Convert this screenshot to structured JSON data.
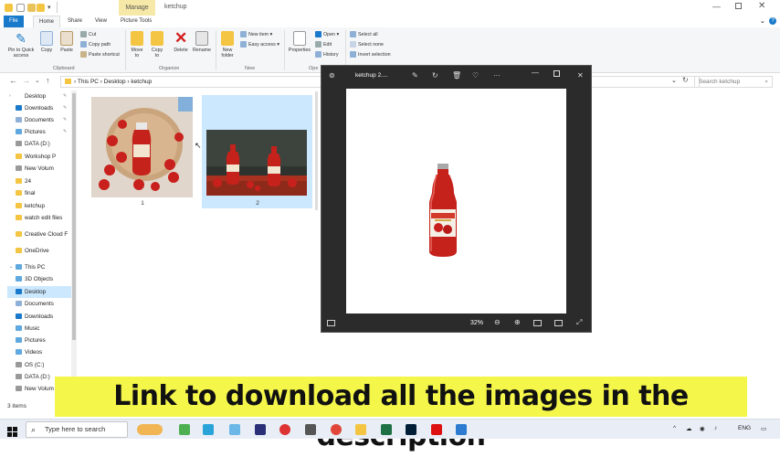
{
  "explorer": {
    "title": "ketchup",
    "contextual_tab": "Manage",
    "tabs": [
      "File",
      "Home",
      "Share",
      "View",
      "Picture Tools"
    ],
    "ribbon": {
      "pin_label": "Pin to Quick access",
      "copy_label": "Copy",
      "paste_label": "Paste",
      "cut_label": "Cut",
      "copy_path_label": "Copy path",
      "paste_shortcut_label": "Paste shortcut",
      "clipboard_group": "Clipboard",
      "move_to_label": "Move to",
      "copy_to_label": "Copy to",
      "delete_label": "Delete",
      "rename_label": "Rename",
      "organize_group": "Organize",
      "new_folder_label": "New folder",
      "new_item_label": "New item",
      "easy_access_label": "Easy access",
      "new_group": "New",
      "properties_label": "Properties",
      "open_label": "Open",
      "edit_label": "Edit",
      "history_label": "History",
      "open_group": "Ope",
      "select_all_label": "Select all",
      "select_none_label": "Select none",
      "invert_selection_label": "Invert selection"
    },
    "address": {
      "crumbs": [
        "This PC",
        "Desktop",
        "ketchup"
      ],
      "search_placeholder": "Search ketchup"
    },
    "nav_items": [
      {
        "label": "Desktop",
        "pinned": true
      },
      {
        "label": "Downloads",
        "pinned": true
      },
      {
        "label": "Documents",
        "pinned": true
      },
      {
        "label": "Pictures",
        "pinned": true
      },
      {
        "label": "DATA (D:)",
        "pinned": true
      },
      {
        "label": "Workshop P",
        "pinned": true
      },
      {
        "label": "New Volum",
        "pinned": true
      },
      {
        "label": "24",
        "pinned": false
      },
      {
        "label": "final",
        "pinned": false
      },
      {
        "label": "ketchup",
        "pinned": false
      },
      {
        "label": "watch edit files",
        "pinned": false
      },
      {
        "label": "Creative Cloud F",
        "pinned": false
      },
      {
        "label": "OneDrive",
        "pinned": false
      },
      {
        "label": "This PC",
        "pinned": false
      },
      {
        "label": "3D Objects",
        "pinned": false
      },
      {
        "label": "Desktop",
        "pinned": false
      },
      {
        "label": "Documents",
        "pinned": false
      },
      {
        "label": "Downloads",
        "pinned": false
      },
      {
        "label": "Music",
        "pinned": false
      },
      {
        "label": "Pictures",
        "pinned": false
      },
      {
        "label": "Videos",
        "pinned": false
      },
      {
        "label": "OS (C:)",
        "pinned": false
      },
      {
        "label": "DATA (D:)",
        "pinned": false
      },
      {
        "label": "New Volum",
        "pinned": false
      }
    ],
    "files": [
      {
        "name": "1"
      },
      {
        "name": "2"
      }
    ],
    "status": "3 items"
  },
  "photos": {
    "title": "ketchup 2....",
    "zoom": "32%"
  },
  "banner": {
    "text": "Link to download all the images in the description"
  },
  "taskbar": {
    "search_placeholder": "Type here to search",
    "language": "ENG"
  },
  "colors": {
    "accent": "#1979ca",
    "banner": "#f5f64a",
    "photos_bg": "#2b2b2b",
    "ketchup_red": "#c4221b"
  }
}
